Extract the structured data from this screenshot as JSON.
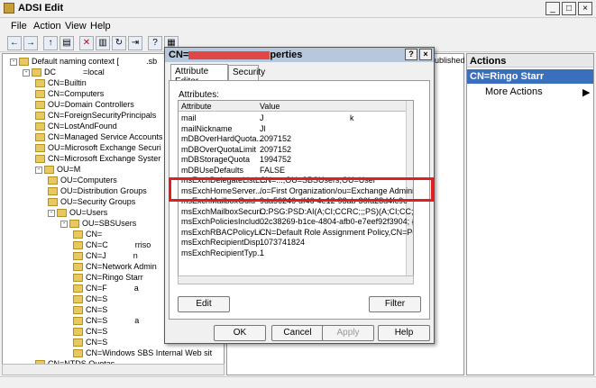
{
  "window": {
    "title": "ADSI Edit"
  },
  "menu": [
    "File",
    "Action",
    "View",
    "Help"
  ],
  "tree": [
    {
      "label": "Default naming context [",
      "ext": ".sb",
      "level": 0,
      "exp": "-"
    },
    {
      "label": "DC",
      "ext": "=local",
      "level": 1,
      "exp": "-"
    },
    {
      "label": "CN=Builtin",
      "ext": "",
      "level": 2,
      "exp": ""
    },
    {
      "label": "CN=Computers",
      "ext": "",
      "level": 2,
      "exp": ""
    },
    {
      "label": "OU=Domain Controllers",
      "ext": "",
      "level": 2,
      "exp": ""
    },
    {
      "label": "CN=ForeignSecurityPrincipals",
      "ext": "",
      "level": 2,
      "exp": ""
    },
    {
      "label": "CN=LostAndFound",
      "ext": "",
      "level": 2,
      "exp": ""
    },
    {
      "label": "CN=Managed Service Accounts",
      "ext": "",
      "level": 2,
      "exp": ""
    },
    {
      "label": "OU=Microsoft Exchange Securi",
      "ext": "",
      "level": 2,
      "exp": ""
    },
    {
      "label": "CN=Microsoft Exchange Syster",
      "ext": "",
      "level": 2,
      "exp": ""
    },
    {
      "label": "OU=M",
      "ext": "",
      "level": 2,
      "exp": "-"
    },
    {
      "label": "OU=Computers",
      "ext": "",
      "level": 3,
      "exp": ""
    },
    {
      "label": "OU=Distribution Groups",
      "ext": "",
      "level": 3,
      "exp": ""
    },
    {
      "label": "OU=Security Groups",
      "ext": "",
      "level": 3,
      "exp": ""
    },
    {
      "label": "OU=Users",
      "ext": "",
      "level": 3,
      "exp": "-"
    },
    {
      "label": "OU=SBSUsers",
      "ext": "",
      "level": 4,
      "exp": "-"
    },
    {
      "label": "CN=",
      "ext": "",
      "level": 5,
      "exp": ""
    },
    {
      "label": "CN=C",
      "ext": "rriso",
      "level": 5,
      "exp": ""
    },
    {
      "label": "CN=J",
      "ext": "n",
      "level": 5,
      "exp": ""
    },
    {
      "label": "CN=Network Admin",
      "ext": "",
      "level": 5,
      "exp": ""
    },
    {
      "label": "CN=Ringo Starr",
      "ext": "",
      "level": 5,
      "exp": ""
    },
    {
      "label": "CN=F",
      "ext": "a",
      "level": 5,
      "exp": ""
    },
    {
      "label": "CN=S",
      "ext": "",
      "level": 5,
      "exp": ""
    },
    {
      "label": "CN=S",
      "ext": "",
      "level": 5,
      "exp": ""
    },
    {
      "label": "CN=S",
      "ext": "a",
      "level": 5,
      "exp": ""
    },
    {
      "label": "CN=S",
      "ext": "",
      "level": 5,
      "exp": ""
    },
    {
      "label": "CN=S",
      "ext": "",
      "level": 5,
      "exp": ""
    },
    {
      "label": "CN=Windows SBS Internal Web sit",
      "ext": "",
      "level": 5,
      "exp": ""
    },
    {
      "label": "CN=NTDS Quotas",
      "ext": "",
      "level": 2,
      "exp": ""
    }
  ],
  "mid": {
    "header": "ublished N"
  },
  "actions": {
    "title": "Actions",
    "selected": "CN=Ringo Starr",
    "more": "More Actions"
  },
  "dialog": {
    "title": "CN=",
    "title_suffix": "perties",
    "tabs": [
      "Attribute Editor",
      "Security"
    ],
    "attributes_label": "Attributes:",
    "col_attribute": "Attribute",
    "col_value": "Value",
    "rows": [
      {
        "attr": "mail",
        "value": "J",
        "value2": "k"
      },
      {
        "attr": "mailNickname",
        "value": "Jl",
        "value2": ""
      },
      {
        "attr": "mDBOverHardQuota...",
        "value": "2097152",
        "value2": ""
      },
      {
        "attr": "mDBOverQuotaLimit",
        "value": "2097152",
        "value2": ""
      },
      {
        "attr": "mDBStorageQuota",
        "value": "1994752",
        "value2": ""
      },
      {
        "attr": "mDBUseDefaults",
        "value": "FALSE",
        "value2": ""
      },
      {
        "attr": "msExchDelegateListL...",
        "value": "CN=...,OU=SBSUsers,OU=User",
        "value2": ""
      },
      {
        "attr": "msExchHomeServer...",
        "value": "/o=First Organization/ou=Exchange Administ",
        "value2": ""
      },
      {
        "attr": "msExchMailboxGuid",
        "value": "9da56246-df46-4e12-93ab-36fa28d4fc9c",
        "value2": ""
      },
      {
        "attr": "msExchMailboxSecuri...",
        "value": "O:PSG:PSD:AI(A;CI;CCRC;;;PS)(A;CI;CC;;;S-",
        "value2": ""
      },
      {
        "attr": "msExchPoliciesInclud...",
        "value": "02c38269-b1ce-4804-afb0-e7eef92f3904; {2",
        "value2": ""
      },
      {
        "attr": "msExchRBACPolicyLi...",
        "value": "CN=Default Role Assignment Policy,CN=Polic",
        "value2": ""
      },
      {
        "attr": "msExchRecipientDisp...",
        "value": "1073741824",
        "value2": ""
      },
      {
        "attr": "msExchRecipientTyp...",
        "value": "1",
        "value2": ""
      }
    ],
    "edit_label": "Edit",
    "filter_label": "Filter",
    "ok_label": "OK",
    "cancel_label": "Cancel",
    "apply_label": "Apply",
    "help_label": "Help"
  },
  "colors": {
    "selection": "#3a6fbd",
    "highlight": "#e02020"
  }
}
